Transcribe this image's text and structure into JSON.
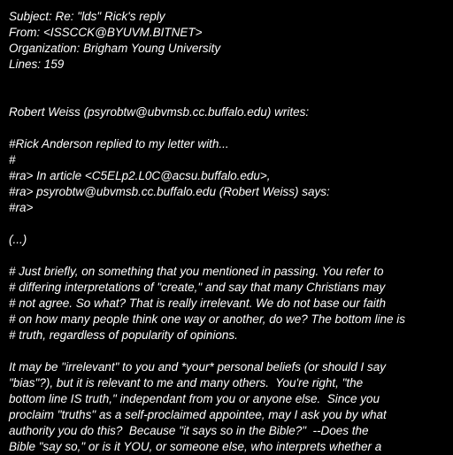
{
  "header": {
    "subject": "Subject: Re: \"lds\" Rick's reply",
    "from": "From: <ISSCCK@BYUVM.BITNET>",
    "organization": "Organization: Brigham Young University",
    "lines": "Lines: 159"
  },
  "attribution": "Robert Weiss (psyrobtw@ubvmsb.cc.buffalo.edu) writes:",
  "quote_block_1": [
    "#Rick Anderson replied to my letter with...",
    "#",
    "#ra> In article <C5ELp2.L0C@acsu.buffalo.edu>,",
    "#ra> psyrobtw@ubvmsb.cc.buffalo.edu (Robert Weiss) says:",
    "#ra>"
  ],
  "ellipsis": "(...)",
  "quote_block_2": [
    "# Just briefly, on something that you mentioned in passing. You refer to",
    "# differing interpretations of \"create,\" and say that many Christians may",
    "# not agree. So what? That is really irrelevant. We do not base our faith",
    "# on how many people think one way or another, do we? The bottom line is",
    "# truth, regardless of popularity of opinions."
  ],
  "reply_paragraph": [
    "It may be \"irrelevant\" to you and *your* personal beliefs (or should I say",
    "\"bias\"?), but it is relevant to me and many others.  You're right, \"the",
    "bottom line IS truth,\" independant from you or anyone else.  Since you",
    "proclaim \"truths\" as a self-proclaimed appointee, may I ask you by what",
    "authority you do this?  Because \"it says so in the Bible?\"  --Does the",
    "Bible \"say so,\" or is it YOU, or someone else, who interprets whether a"
  ]
}
